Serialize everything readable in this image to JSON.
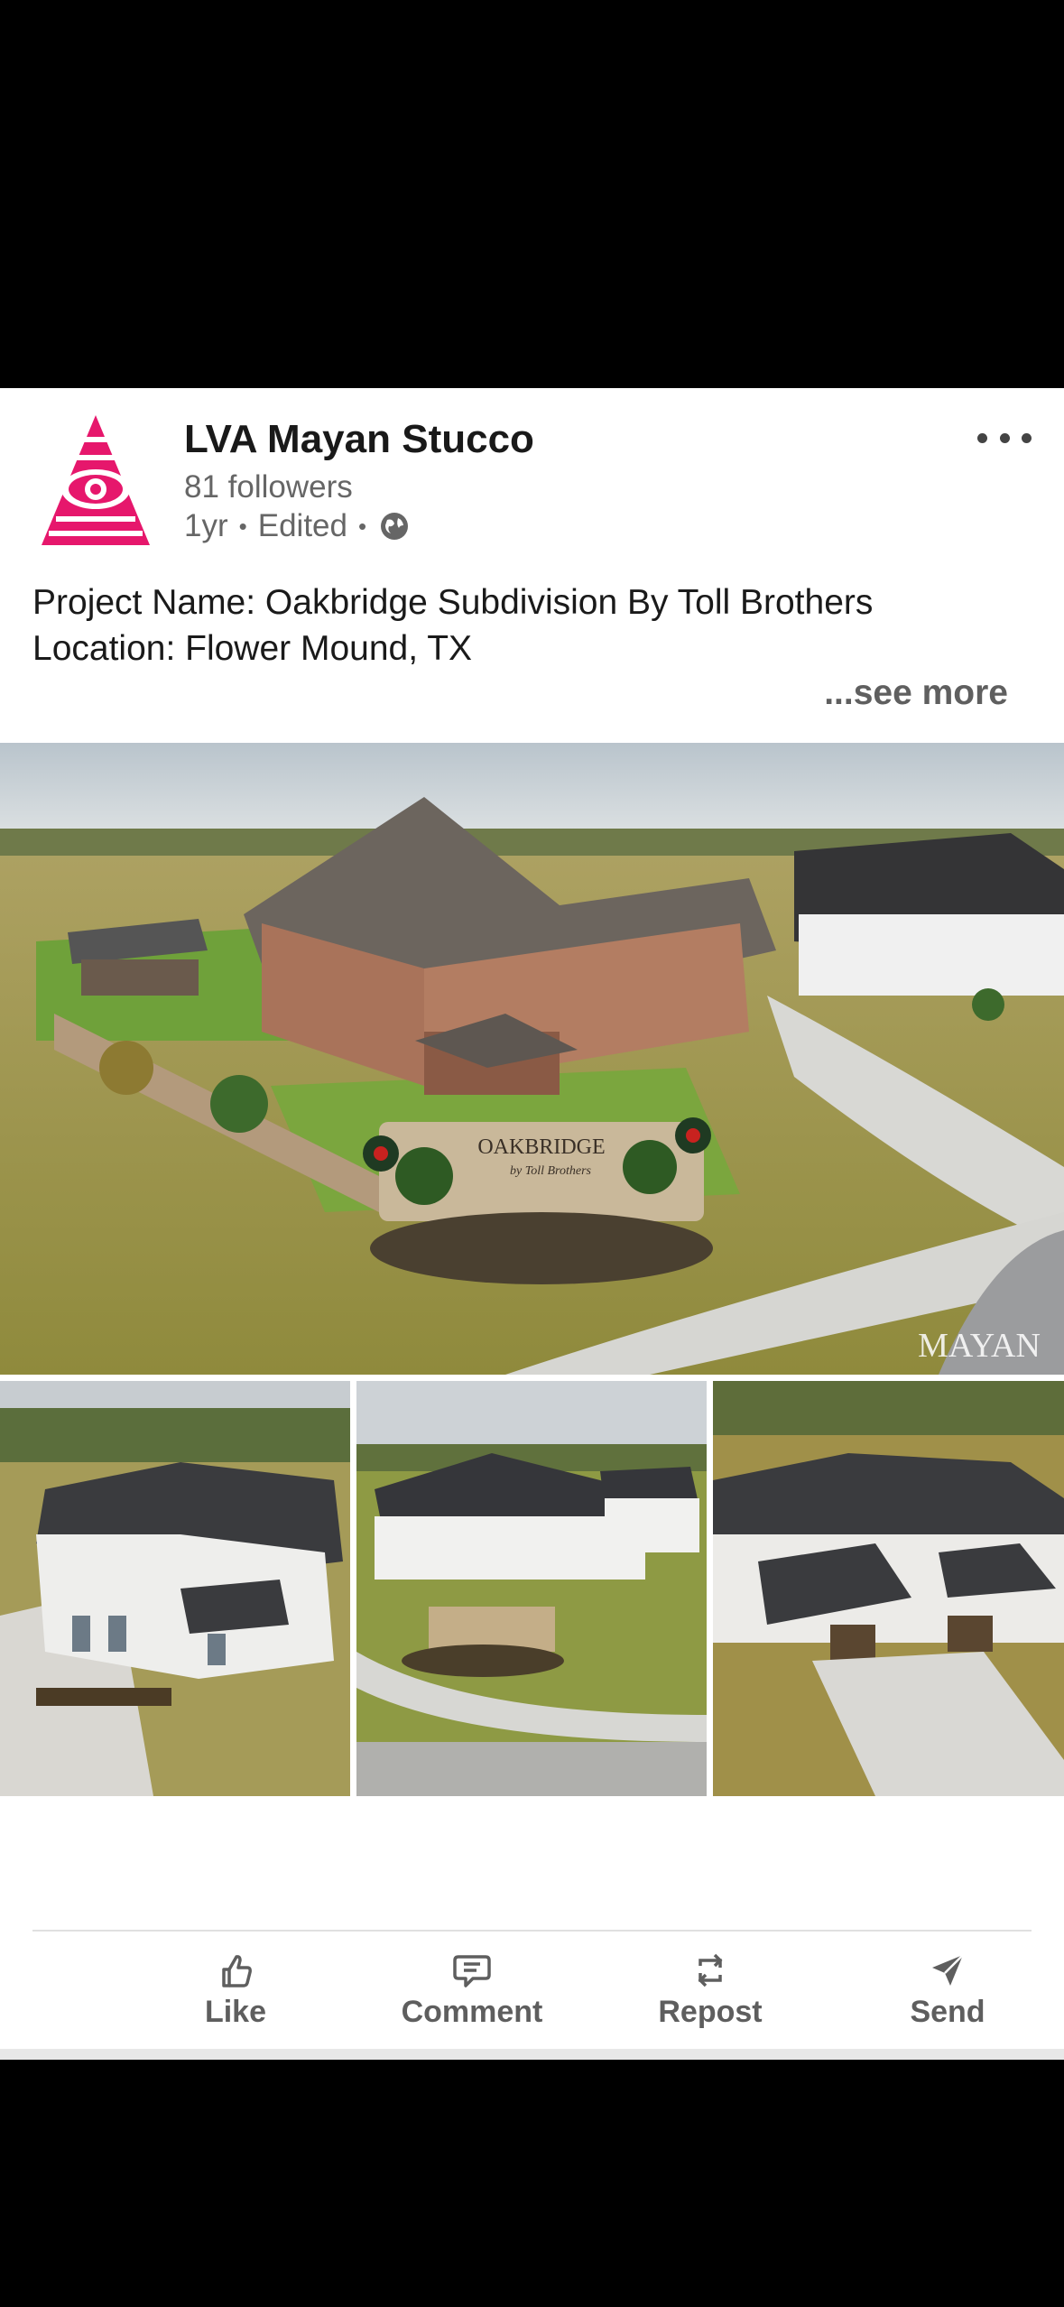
{
  "post": {
    "author": "LVA Mayan Stucco",
    "followers": "81 followers",
    "age": "1yr",
    "edited": "Edited",
    "text_line1": "Project Name: Oakbridge Subdivision By Toll Brothers",
    "text_line2": "Location: Flower Mound, TX",
    "see_more": "...see more",
    "sign_text": "OAKBRIDGE",
    "sign_sub": "by Toll Brothers",
    "watermark": "MAYAN"
  },
  "actions": {
    "like": "Like",
    "comment": "Comment",
    "repost": "Repost",
    "send": "Send"
  },
  "icons": {
    "more": "more-options-icon",
    "globe": "globe-icon",
    "like": "thumbs-up-icon",
    "comment": "comment-bubble-icon",
    "repost": "repost-icon",
    "send": "send-icon"
  },
  "colors": {
    "brand": "#e6176c",
    "action_gray": "#5e5e5e"
  }
}
